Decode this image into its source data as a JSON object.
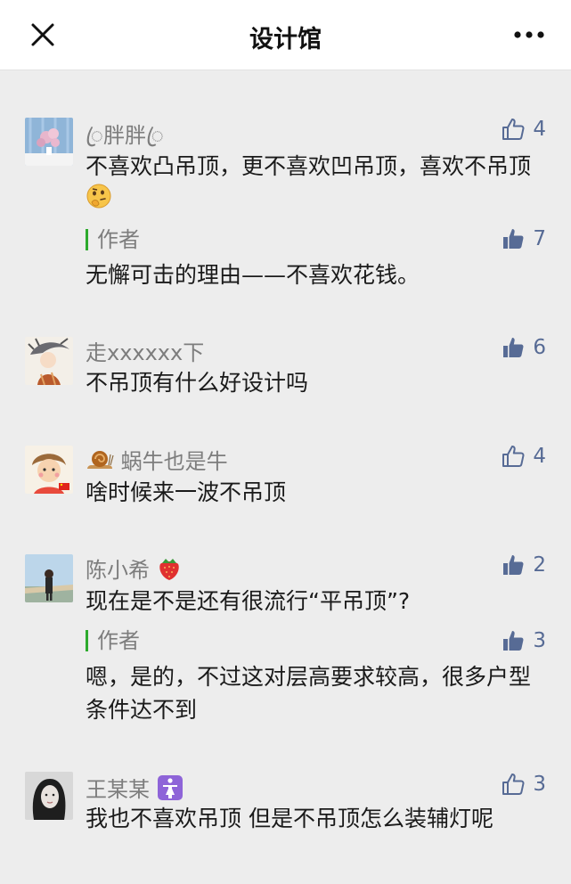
{
  "header": {
    "title": "设计馆",
    "close_icon": "close-icon",
    "more_icon": "more-icon"
  },
  "comments": [
    {
      "nickname": "ꦿ胖胖ꦿ",
      "likes": "4",
      "liked": false,
      "text": "不喜欢凸吊顶，更不喜欢凹吊顶，喜欢不吊顶",
      "reply": {
        "label": "作者",
        "likes": "7",
        "text": "无懈可击的理由——不喜欢花钱。"
      }
    },
    {
      "nickname": "走xxxxxx下",
      "likes": "6",
      "liked": true,
      "text": "不吊顶有什么好设计吗"
    },
    {
      "nickname": "蜗牛也是牛",
      "likes": "4",
      "liked": false,
      "text": "啥时候来一波不吊顶"
    },
    {
      "nickname": "陈小希",
      "likes": "2",
      "liked": true,
      "text": "现在是不是还有很流行“平吊顶”?",
      "reply": {
        "label": "作者",
        "likes": "3",
        "text": "嗯，是的，不过这对层高要求较高，很多户型条件达不到"
      }
    },
    {
      "nickname": "王某某",
      "likes": "3",
      "liked": false,
      "text": "我也不喜欢吊顶 但是不吊顶怎么装辅灯呢"
    }
  ],
  "colors": {
    "link": "#576b95",
    "author_bar": "#2daa2d",
    "nickname": "#7d7d7d",
    "background": "#ededed"
  }
}
